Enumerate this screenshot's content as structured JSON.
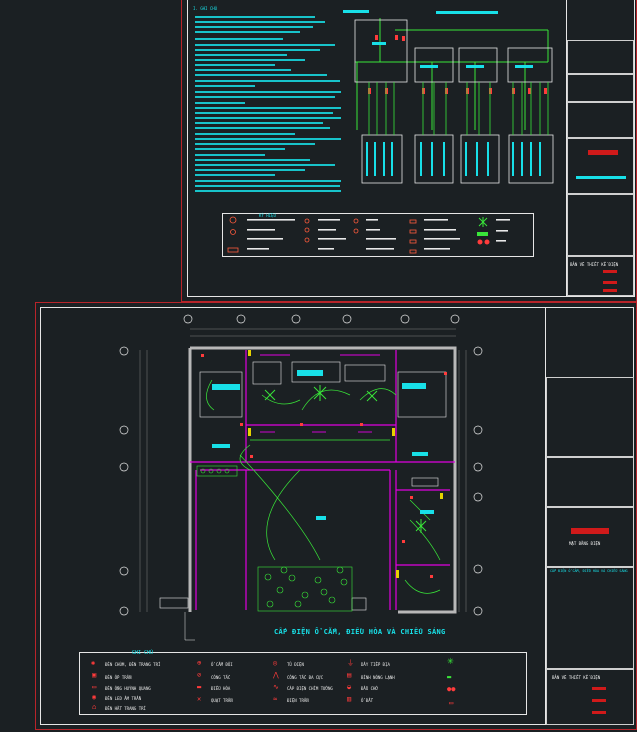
{
  "top_sheet": {
    "notes_heading": "I. GHI CHÚ",
    "legend_title": "KÝ HIỆU",
    "title_block_caption": "BẢN VẼ THIẾT KẾ ĐIỆN"
  },
  "bottom_sheet": {
    "plan_title": "CẤP ĐIỆN Ổ CẮM, ĐIỀU HÒA VÀ CHIẾU SÁNG",
    "legend_title": "GHI CHÚ",
    "title_block_caption": "MẶT BẰNG ĐIỆN",
    "title_block_drawing": "CẤP ĐIỆN Ổ CẮM, ĐIỀU HÒA VÀ CHIẾU SÁNG",
    "title_block_bottom": "BẢN VẼ THIẾT KẾ ĐIỆN",
    "legend_items": [
      "ĐÈN CHÙM, ĐÈN TRANG TRÍ",
      "ĐÈN ỐP TRẦN",
      "ĐÈN ỐNG HUỲNH QUANG",
      "ĐÈN LED ÂM TRẦN",
      "ĐÈN HẮT TRANG TRÍ",
      "Ổ CẮM ĐÔI",
      "CÔNG TẮC",
      "ĐIỀU HÒA",
      "QUẠT TRẦN",
      "TỦ ĐIỆN",
      "CÔNG TẮC BA CỰC",
      "CÁP ĐIỆN CHÌM TƯỜNG",
      "ĐIỆN TRẦN",
      "DÂY TIẾP ĐỊA",
      "BÌNH NÓNG LẠNH",
      "ĐẦU CHỜ",
      "Ổ ĐẤT"
    ]
  },
  "colors": {
    "background": "#1b2023",
    "sheet_border": "#b8242a",
    "wall": "#e000e0",
    "wiring": "#39e639",
    "text_cyan": "#18e0e8",
    "title_red": "#d01a1a"
  },
  "icons": [
    "chandelier-icon",
    "ceiling-light-icon",
    "socket-icon",
    "switch-icon",
    "air-conditioner-icon",
    "ceiling-fan-icon",
    "panel-icon"
  ]
}
